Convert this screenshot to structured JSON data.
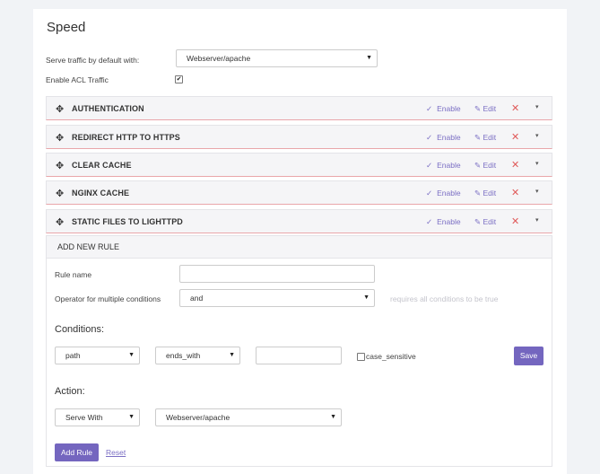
{
  "page": {
    "title": "Speed"
  },
  "settings": {
    "serve_label": "Serve traffic by default with:",
    "serve_value": "Webserver/apache",
    "acl_label": "Enable ACL Traffic",
    "acl_checked": true
  },
  "rules": [
    {
      "name": "AUTHENTICATION",
      "enable": "Enable",
      "edit": "Edit"
    },
    {
      "name": "REDIRECT HTTP TO HTTPS",
      "enable": "Enable",
      "edit": "Edit"
    },
    {
      "name": "CLEAR CACHE",
      "enable": "Enable",
      "edit": "Edit"
    },
    {
      "name": "NGINX CACHE",
      "enable": "Enable",
      "edit": "Edit"
    },
    {
      "name": "STATIC FILES TO LIGHTTPD",
      "enable": "Enable",
      "edit": "Edit"
    }
  ],
  "new_rule": {
    "title": "ADD NEW RULE",
    "rule_name_label": "Rule name",
    "rule_name_value": "",
    "operator_label": "Operator for multiple conditions",
    "operator_value": "and",
    "operator_hint": "requires all conditions to be true",
    "conditions_title": "Conditions:",
    "condition_field": "path",
    "condition_operator": "ends_with",
    "condition_value": "",
    "case_sensitive_label": "case_sensitive",
    "save_label": "Save",
    "action_title": "Action:",
    "action_type": "Serve With",
    "action_target": "Webserver/apache",
    "add_rule_label": "Add Rule",
    "reset_label": "Reset"
  },
  "colors": {
    "accent": "#7466bf",
    "danger": "#e05a5a",
    "rule_border": "#e9a6aa"
  },
  "icons": {
    "move": "move-icon",
    "check": "check-icon",
    "edit": "edit-icon",
    "delete": "close-icon",
    "chevron": "chevron-down-icon"
  }
}
